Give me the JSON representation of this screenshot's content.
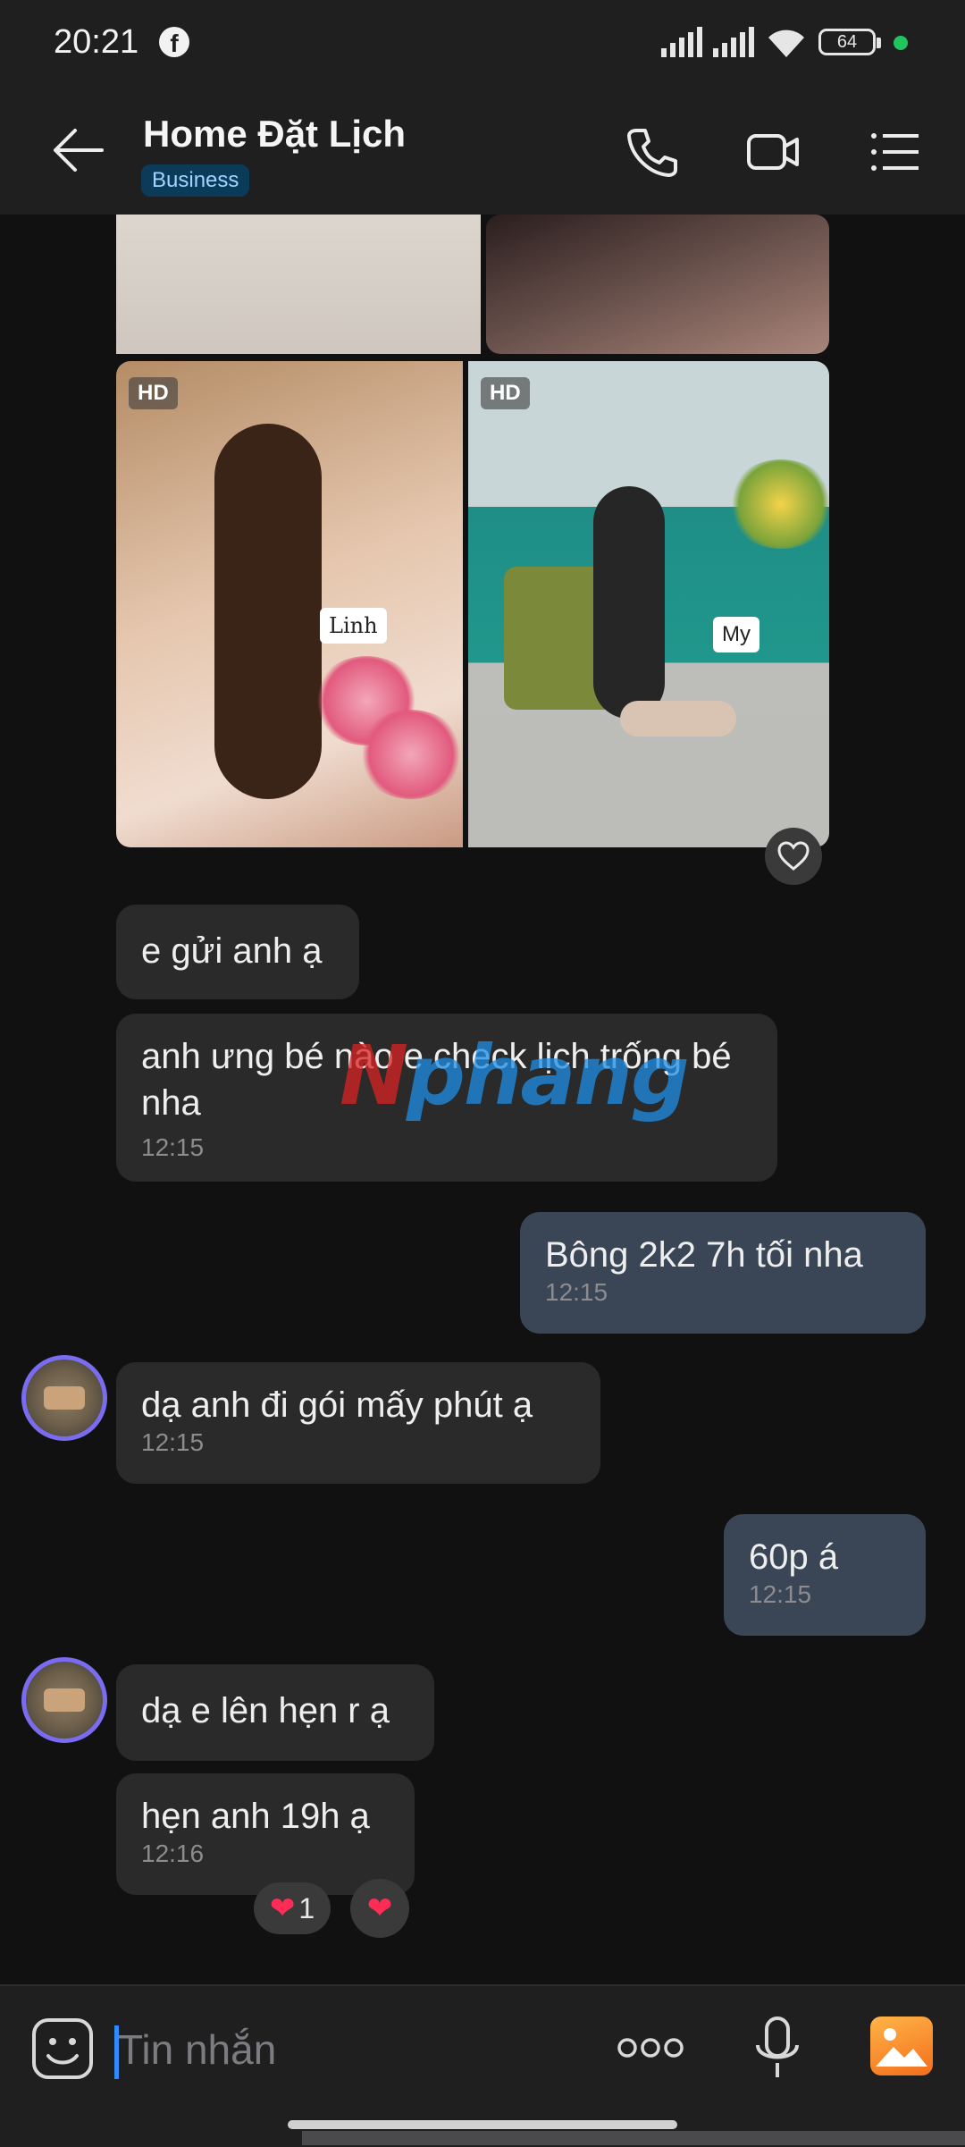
{
  "status_bar": {
    "time": "20:21",
    "battery": "64"
  },
  "header": {
    "title": "Home Đặt Lịch",
    "badge": "Business"
  },
  "images": {
    "hd_label": "HD",
    "tag_left": "Linh",
    "tag_right": "My"
  },
  "messages": [
    {
      "side": "in",
      "text": "e gửi anh ạ"
    },
    {
      "side": "in",
      "text": "anh ưng bé nào e check lịch trống bé nha",
      "time": "12:15"
    },
    {
      "side": "out",
      "text": "Bông 2k2 7h tối nha",
      "time": "12:15"
    },
    {
      "side": "in",
      "text": "dạ anh đi gói mấy phút ạ",
      "time": "12:15"
    },
    {
      "side": "out",
      "text": "60p á",
      "time": "12:15"
    },
    {
      "side": "in",
      "text": "dạ e lên hẹn r ạ"
    },
    {
      "side": "in",
      "text": "hẹn anh 19h ạ",
      "time": "12:16"
    }
  ],
  "reactions": {
    "count": "1"
  },
  "watermark": {
    "part1": "N",
    "part2": "phang"
  },
  "composer": {
    "placeholder": "Tin nhắn"
  },
  "colors": {
    "accent": "#2f8cff",
    "incoming": "#2a2a2b",
    "outgoing": "#3a4656",
    "heart": "#ff2d55"
  }
}
